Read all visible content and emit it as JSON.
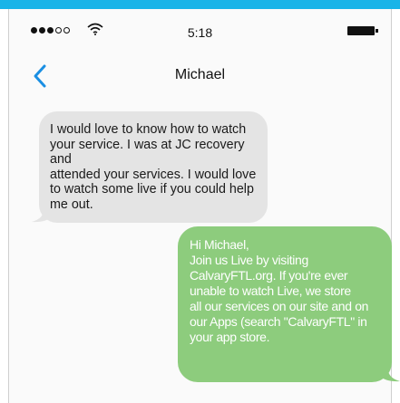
{
  "status_bar": {
    "signal_dots_filled": 3,
    "signal_dots_total": 5,
    "time": "5:18",
    "icons": [
      "signal-dots-icon",
      "wifi-icon",
      "battery-icon"
    ]
  },
  "header": {
    "back_icon": "chevron-left-icon",
    "contact_name": "Michael"
  },
  "messages": [
    {
      "direction": "incoming",
      "text": "I would love to know how to watch\nyour service. I was at JC recovery and\nattended your services. I would love\nto watch some live if you could help\nme out."
    },
    {
      "direction": "outgoing",
      "text": "Hi Michael,\nJoin us Live by visiting\nCalvaryFTL.org. If you're ever\nunable to watch Live, we store\nall our services on our site and on\nour Apps (search \"CalvaryFTL\" in\nyour app store."
    }
  ],
  "colors": {
    "accent": "#19b4e8",
    "back_chevron": "#1a8fe3",
    "incoming_bubble": "#e4e4e4",
    "outgoing_bubble": "#8dcc7d"
  }
}
